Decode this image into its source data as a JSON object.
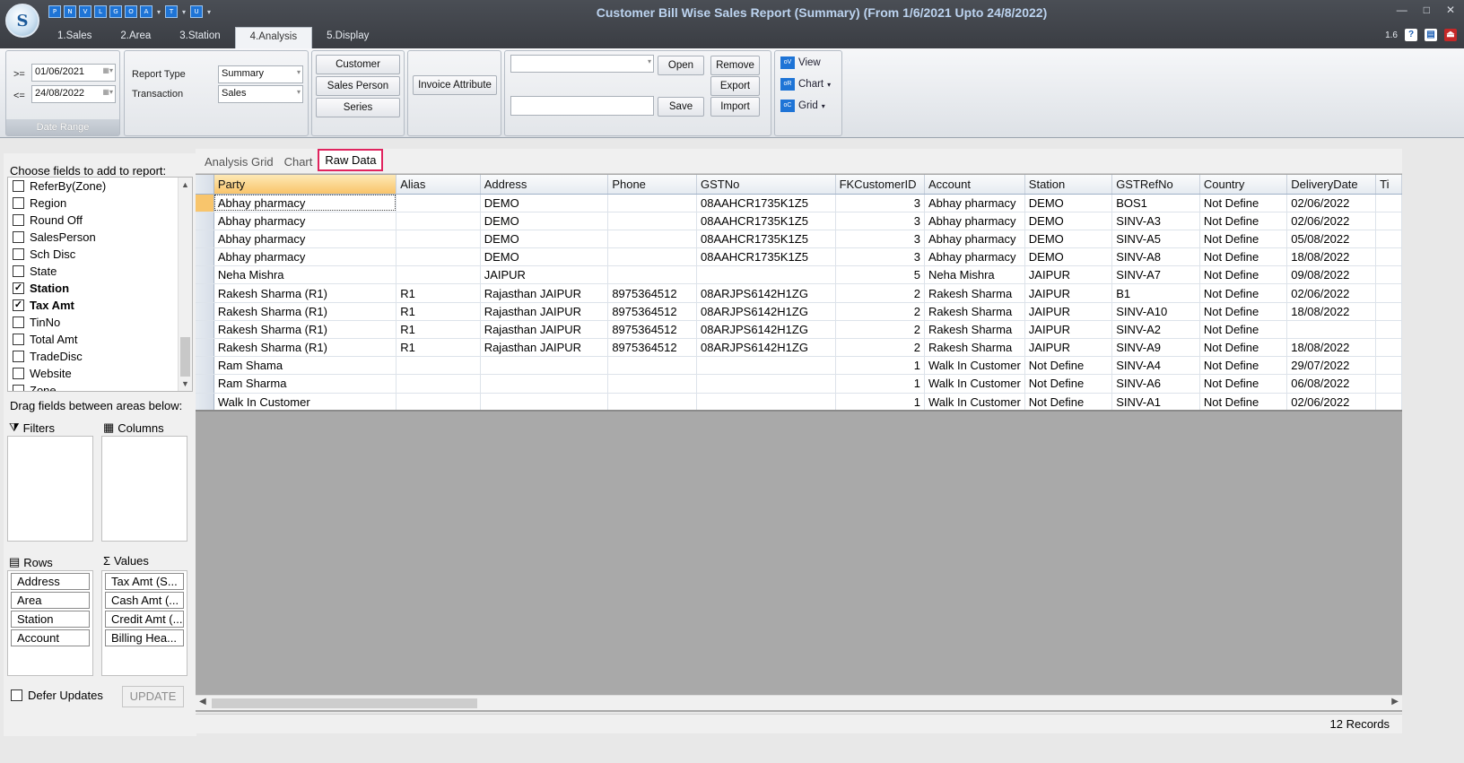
{
  "window": {
    "title": "Customer Bill Wise Sales Report (Summary) (From 1/6/2021 Upto 24/8/2022)",
    "logo_letter": "S",
    "version": "1.6",
    "controls": {
      "minimize": "—",
      "restore": "□",
      "close": "✕"
    }
  },
  "quick_access": [
    "P",
    "N",
    "V",
    "L",
    "G",
    "O",
    "A",
    "T",
    "U"
  ],
  "tabs": [
    {
      "label": "1.Sales"
    },
    {
      "label": "2.Area"
    },
    {
      "label": "3.Station"
    },
    {
      "label": "4.Analysis",
      "active": true
    },
    {
      "label": "5.Display"
    }
  ],
  "ribbon": {
    "date_range": {
      "ge_label": ">=",
      "le_label": "<=",
      "from": "01/06/2021",
      "to": "24/08/2022",
      "group_label": "Date Range"
    },
    "report": {
      "report_type_label": "Report Type",
      "report_type_value": "Summary",
      "transaction_label": "Transaction",
      "transaction_value": "Sales"
    },
    "attribute_buttons": [
      "Customer",
      "Sales Person",
      "Series"
    ],
    "invoice_attribute": "Invoice Attribute",
    "layout": {
      "combo_value": "",
      "name_value": "",
      "open": "Open",
      "remove": "Remove",
      "export": "Export",
      "save": "Save",
      "import": "Import"
    },
    "view": {
      "view": "View",
      "chart": "Chart",
      "grid": "Grid"
    }
  },
  "sidebar": {
    "choose_label": "Choose fields to add to report:",
    "fields": [
      {
        "label": "ReferBy(Zone)",
        "checked": false
      },
      {
        "label": "Region",
        "checked": false
      },
      {
        "label": "Round Off",
        "checked": false
      },
      {
        "label": "SalesPerson",
        "checked": false
      },
      {
        "label": "Sch Disc",
        "checked": false
      },
      {
        "label": "State",
        "checked": false
      },
      {
        "label": "Station",
        "checked": true
      },
      {
        "label": "Tax Amt",
        "checked": true
      },
      {
        "label": "TinNo",
        "checked": false
      },
      {
        "label": "Total Amt",
        "checked": false
      },
      {
        "label": "TradeDisc",
        "checked": false
      },
      {
        "label": "Website",
        "checked": false
      },
      {
        "label": "Zone",
        "checked": false
      }
    ],
    "drag_label": "Drag fields between areas below:",
    "filters_label": "Filters",
    "columns_label": "Columns",
    "rows_label": "Rows",
    "values_label": "Values",
    "rows": [
      "Address",
      "Area",
      "Station",
      "Account"
    ],
    "values": [
      "Tax Amt (S...",
      "Cash Amt (...",
      "Credit Amt (...",
      "Billing Hea..."
    ],
    "defer_label": "Defer Updates",
    "update_label": "UPDATE"
  },
  "view_tabs": [
    {
      "label": "Analysis Grid"
    },
    {
      "label": "Chart"
    },
    {
      "label": "Raw Data",
      "active": true
    }
  ],
  "grid": {
    "columns": [
      "Party",
      "Alias",
      "Address",
      "Phone",
      "GSTNo",
      "FKCustomerID",
      "Account",
      "Station",
      "GSTRefNo",
      "Country",
      "DeliveryDate",
      "Ti"
    ],
    "rows": [
      [
        "Abhay pharmacy",
        "",
        " DEMO",
        "",
        "08AAHCR1735K1Z5",
        "3",
        "Abhay pharmacy",
        "DEMO",
        "BOS1",
        "Not Define",
        "02/06/2022",
        ""
      ],
      [
        "Abhay pharmacy",
        "",
        " DEMO",
        "",
        "08AAHCR1735K1Z5",
        "3",
        "Abhay pharmacy",
        "DEMO",
        "SINV-A3",
        "Not Define",
        "02/06/2022",
        ""
      ],
      [
        "Abhay pharmacy",
        "",
        " DEMO",
        "",
        "08AAHCR1735K1Z5",
        "3",
        "Abhay pharmacy",
        "DEMO",
        "SINV-A5",
        "Not Define",
        "05/08/2022",
        ""
      ],
      [
        "Abhay pharmacy",
        "",
        " DEMO",
        "",
        "08AAHCR1735K1Z5",
        "3",
        "Abhay pharmacy",
        "DEMO",
        "SINV-A8",
        "Not Define",
        "18/08/2022",
        ""
      ],
      [
        "Neha Mishra",
        "",
        " JAIPUR",
        "",
        "",
        "5",
        "Neha Mishra",
        "JAIPUR",
        "SINV-A7",
        "Not Define",
        "09/08/2022",
        ""
      ],
      [
        "Rakesh Sharma (R1)",
        "R1",
        "Rajasthan  JAIPUR",
        "8975364512",
        "08ARJPS6142H1ZG",
        "2",
        "Rakesh Sharma",
        "JAIPUR",
        "B1",
        "Not Define",
        "02/06/2022",
        ""
      ],
      [
        "Rakesh Sharma (R1)",
        "R1",
        "Rajasthan  JAIPUR",
        "8975364512",
        "08ARJPS6142H1ZG",
        "2",
        "Rakesh Sharma",
        "JAIPUR",
        "SINV-A10",
        "Not Define",
        "18/08/2022",
        ""
      ],
      [
        "Rakesh Sharma (R1)",
        "R1",
        "Rajasthan  JAIPUR",
        "8975364512",
        "08ARJPS6142H1ZG",
        "2",
        "Rakesh Sharma",
        "JAIPUR",
        "SINV-A2",
        "Not Define",
        "",
        ""
      ],
      [
        "Rakesh Sharma (R1)",
        "R1",
        "Rajasthan  JAIPUR",
        "8975364512",
        "08ARJPS6142H1ZG",
        "2",
        "Rakesh Sharma",
        "JAIPUR",
        "SINV-A9",
        "Not Define",
        "18/08/2022",
        ""
      ],
      [
        "Ram Shama",
        "",
        "",
        "",
        "",
        "1",
        "Walk In Customer",
        "Not Define",
        "SINV-A4",
        "Not Define",
        "29/07/2022",
        ""
      ],
      [
        "Ram Sharma",
        "",
        "",
        "",
        "",
        "1",
        "Walk In Customer",
        "Not Define",
        "SINV-A6",
        "Not Define",
        "06/08/2022",
        ""
      ],
      [
        "Walk In Customer",
        "",
        "",
        "",
        "",
        "1",
        "Walk In Customer",
        "Not Define",
        "SINV-A1",
        "Not Define",
        "02/06/2022",
        ""
      ]
    ]
  },
  "status": {
    "records": "12 Records"
  }
}
